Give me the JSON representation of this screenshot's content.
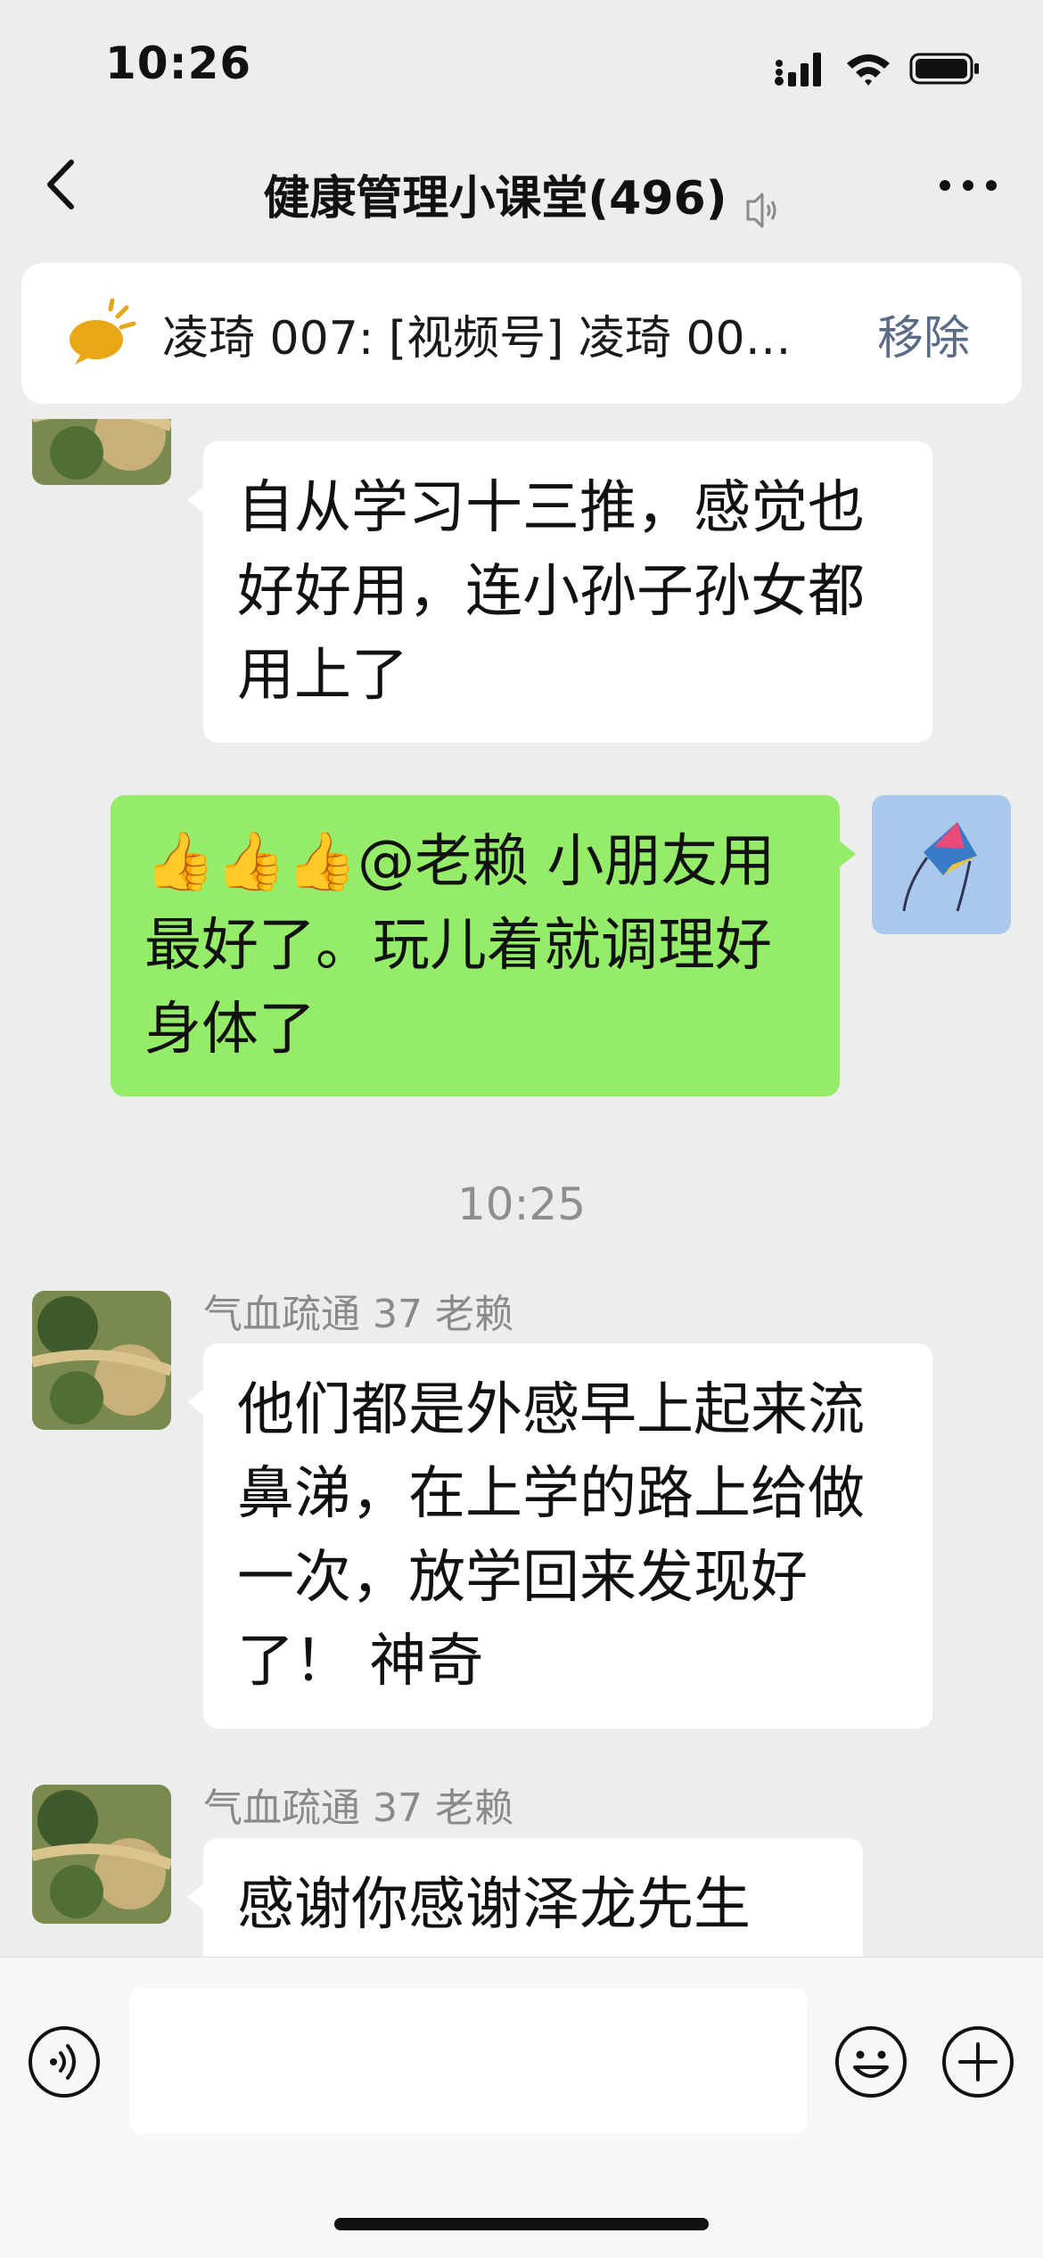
{
  "status_bar": {
    "time": "10:26"
  },
  "header": {
    "title": "健康管理小课堂(496)"
  },
  "pinned": {
    "text": "凌琦 007: [视频号] 凌琦 00…",
    "remove_label": "移除"
  },
  "messages": [
    {
      "side": "left",
      "sender": "",
      "text": "自从学习十三推，感觉也好好用，连小孙子孙女都用上了"
    },
    {
      "side": "right",
      "emoji_prefix": "👍👍👍",
      "text": "@老赖 小朋友用最好了。玩儿着就调理好身体了"
    },
    {
      "timestamp": "10:25"
    },
    {
      "side": "left",
      "sender": "气血疏通 37 老赖",
      "text": "他们都是外感早上起来流鼻涕，在上学的路上给做一次，放学回来发现好了！ 神奇"
    },
    {
      "side": "left",
      "sender": "气血疏通 37 老赖",
      "text": "感谢你感谢泽龙先生"
    }
  ],
  "colors": {
    "green_bubble": "#95ec69",
    "white_bubble": "#ffffff",
    "background": "#ededed",
    "link_gray_blue": "#5b6b85"
  },
  "icons": [
    "back-chevron-icon",
    "mute-icon",
    "more-icon",
    "pin-speaker-icon",
    "voice-icon",
    "emoji-icon",
    "plus-icon"
  ]
}
